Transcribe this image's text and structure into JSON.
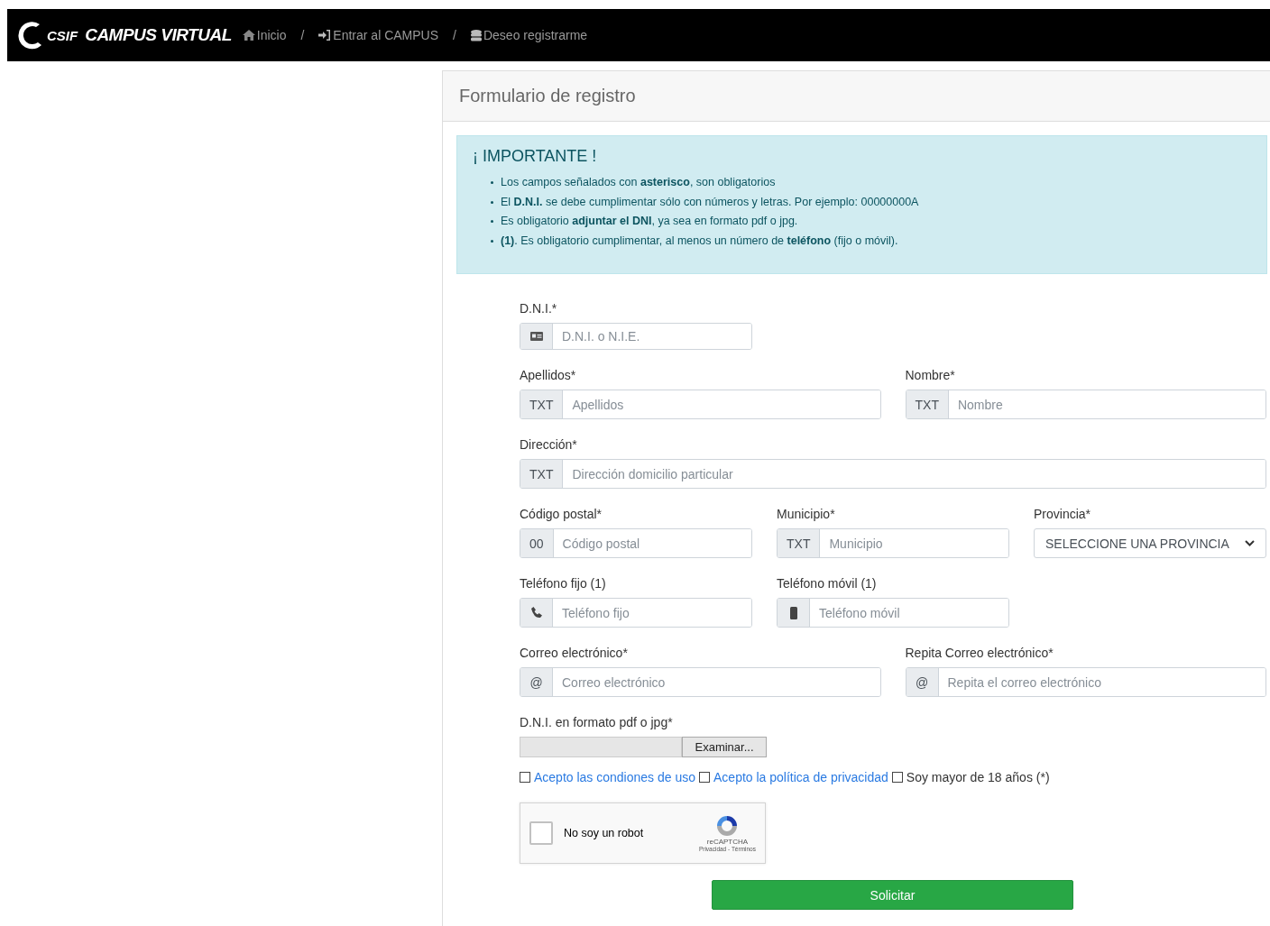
{
  "navbar": {
    "logo": "CSIF",
    "brand": "CAMPUS VIRTUAL",
    "breadcrumb": [
      {
        "kind": "home",
        "label": "Inicio"
      },
      {
        "kind": "login",
        "label": "Entrar al CAMPUS"
      },
      {
        "kind": "database",
        "label": "Deseo registrarme"
      }
    ],
    "separator": "/"
  },
  "panel": {
    "title": "Formulario de registro"
  },
  "alert": {
    "title": "¡ IMPORTANTE !",
    "items": [
      "Los campos señalados con **asterisco**, son obligatorios",
      "El **D.N.I.** se debe cumplimentar sólo con números y letras. Por ejemplo: 00000000A",
      "Es obligatorio **adjuntar el DNI**, ya sea en formato pdf o jpg.",
      "**(1)**. Es obligatorio cumplimentar, al menos un número de **teléfono** (fijo o móvil)."
    ]
  },
  "form": {
    "rows": [
      [
        {
          "label": "D.N.I.*",
          "kind": "input",
          "addon": {
            "kind": "id_card"
          },
          "placeholder": "D.N.I. o N.I.E."
        }
      ],
      [
        {
          "label": "Apellidos*",
          "kind": "input",
          "addon": {
            "kind": "text",
            "text": "TXT"
          },
          "placeholder": "Apellidos"
        },
        {
          "label": "Nombre*",
          "kind": "input",
          "addon": {
            "kind": "text",
            "text": "TXT"
          },
          "placeholder": "Nombre"
        }
      ],
      [
        {
          "label": "Dirección*",
          "kind": "input",
          "addon": {
            "kind": "text",
            "text": "TXT"
          },
          "placeholder": "Dirección domicilio particular"
        }
      ],
      [
        {
          "label": "Código postal*",
          "kind": "input",
          "addon": {
            "kind": "text",
            "text": "00"
          },
          "placeholder": "Código postal"
        },
        {
          "label": "Municipio*",
          "kind": "input",
          "addon": {
            "kind": "text",
            "text": "TXT"
          },
          "placeholder": "Municipio"
        },
        {
          "label": "Provincia*",
          "kind": "select",
          "value": "SELECCIONE UNA PROVINCIA"
        }
      ],
      [
        {
          "label": "Teléfono fijo (1)",
          "kind": "input",
          "addon": {
            "kind": "phone"
          },
          "placeholder": "Teléfono fijo"
        },
        {
          "label": "Teléfono móvil (1)",
          "kind": "input",
          "addon": {
            "kind": "mobile"
          },
          "placeholder": "Teléfono móvil"
        }
      ],
      [
        {
          "label": "Correo electrónico*",
          "kind": "input",
          "addon": {
            "kind": "text",
            "text": "@"
          },
          "placeholder": "Correo electrónico"
        },
        {
          "label": "Repita Correo electrónico*",
          "kind": "input",
          "addon": {
            "kind": "text",
            "text": "@"
          },
          "placeholder": "Repita el correo electrónico"
        }
      ]
    ],
    "file": {
      "label": "D.N.I. en formato pdf o jpg*",
      "button": "Examinar..."
    },
    "checkboxes": [
      {
        "kind": "link",
        "label": "Acepto las condiones de uso",
        "checked": false
      },
      {
        "kind": "link",
        "label": "Acepto la política de privacidad",
        "checked": false
      },
      {
        "kind": "text",
        "label": "Soy mayor de 18 años (*)",
        "checked": false
      }
    ],
    "captcha": {
      "label": "No soy un robot",
      "checked": false,
      "brand": "reCAPTCHA",
      "links": "Privacidad - Términos"
    },
    "submit": "Solicitar"
  }
}
